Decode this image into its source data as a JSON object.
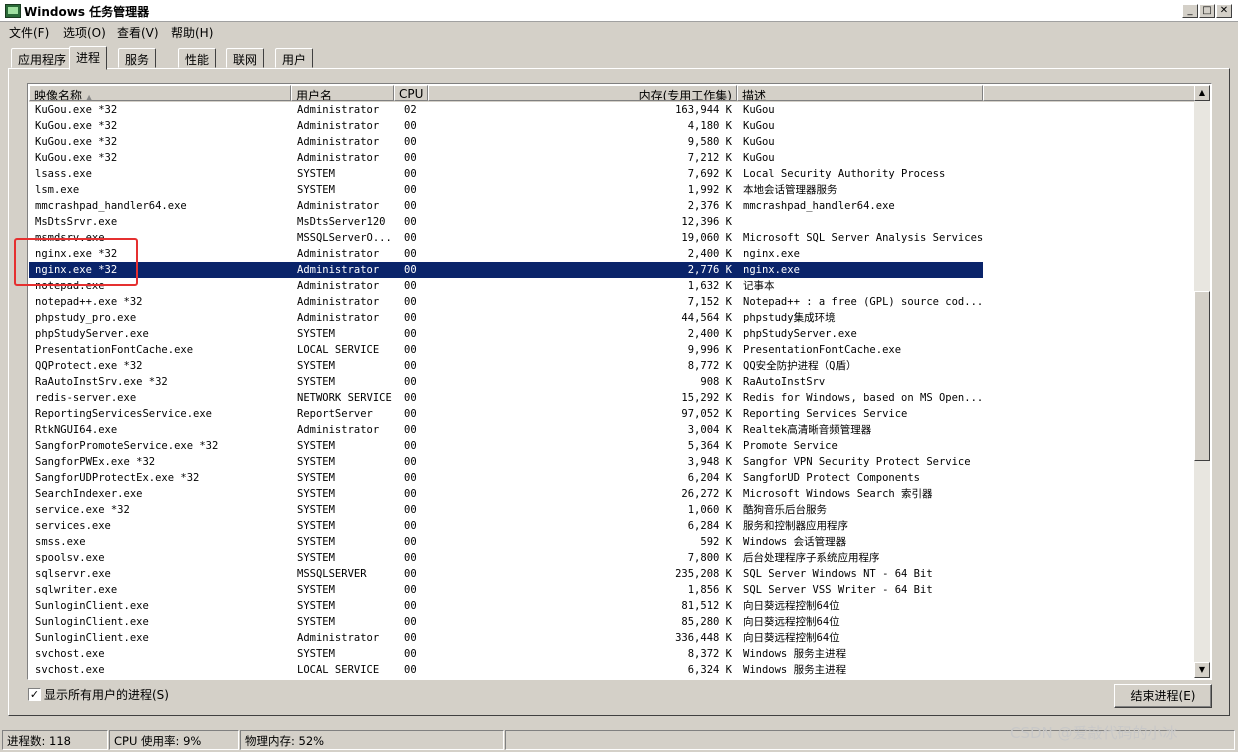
{
  "window": {
    "title": "Windows 任务管理器",
    "buttons": [
      "_",
      "□",
      "✕"
    ]
  },
  "menu": [
    "文件(F)",
    "选项(O)",
    "查看(V)",
    "帮助(H)"
  ],
  "tabs": [
    "应用程序",
    "进程",
    "服务",
    "性能",
    "联网",
    "用户"
  ],
  "active_tab": "进程",
  "columns": [
    "映像名称",
    "用户名",
    "CPU",
    "内存(专用工作集)",
    "描述"
  ],
  "processes": [
    {
      "name": "KuGou.exe *32",
      "user": "Administrator",
      "cpu": "02",
      "mem": "163,944 K",
      "desc": "KuGou"
    },
    {
      "name": "KuGou.exe *32",
      "user": "Administrator",
      "cpu": "00",
      "mem": "4,180 K",
      "desc": "KuGou"
    },
    {
      "name": "KuGou.exe *32",
      "user": "Administrator",
      "cpu": "00",
      "mem": "9,580 K",
      "desc": "KuGou"
    },
    {
      "name": "KuGou.exe *32",
      "user": "Administrator",
      "cpu": "00",
      "mem": "7,212 K",
      "desc": "KuGou"
    },
    {
      "name": "lsass.exe",
      "user": "SYSTEM",
      "cpu": "00",
      "mem": "7,692 K",
      "desc": "Local Security Authority Process"
    },
    {
      "name": "lsm.exe",
      "user": "SYSTEM",
      "cpu": "00",
      "mem": "1,992 K",
      "desc": "本地会话管理器服务"
    },
    {
      "name": "mmcrashpad_handler64.exe",
      "user": "Administrator",
      "cpu": "00",
      "mem": "2,376 K",
      "desc": "mmcrashpad_handler64.exe"
    },
    {
      "name": "MsDtsSrvr.exe",
      "user": "MsDtsServer120",
      "cpu": "00",
      "mem": "12,396 K",
      "desc": ""
    },
    {
      "name": "msmdsrv.exe",
      "user": "MSSQLServerO...",
      "cpu": "00",
      "mem": "19,060 K",
      "desc": "Microsoft SQL Server Analysis Services"
    },
    {
      "name": "nginx.exe *32",
      "user": "Administrator",
      "cpu": "00",
      "mem": "2,400 K",
      "desc": "nginx.exe"
    },
    {
      "name": "nginx.exe *32",
      "user": "Administrator",
      "cpu": "00",
      "mem": "2,776 K",
      "desc": "nginx.exe",
      "selected": true
    },
    {
      "name": "notepad.exe",
      "user": "Administrator",
      "cpu": "00",
      "mem": "1,632 K",
      "desc": "记事本"
    },
    {
      "name": "notepad++.exe *32",
      "user": "Administrator",
      "cpu": "00",
      "mem": "7,152 K",
      "desc": "Notepad++ : a free (GPL) source cod..."
    },
    {
      "name": "phpstudy_pro.exe",
      "user": "Administrator",
      "cpu": "00",
      "mem": "44,564 K",
      "desc": "phpstudy集成环境"
    },
    {
      "name": "phpStudyServer.exe",
      "user": "SYSTEM",
      "cpu": "00",
      "mem": "2,400 K",
      "desc": "phpStudyServer.exe"
    },
    {
      "name": "PresentationFontCache.exe",
      "user": "LOCAL SERVICE",
      "cpu": "00",
      "mem": "9,996 K",
      "desc": "PresentationFontCache.exe"
    },
    {
      "name": "QQProtect.exe *32",
      "user": "SYSTEM",
      "cpu": "00",
      "mem": "8,772 K",
      "desc": "QQ安全防护进程（Q盾）"
    },
    {
      "name": "RaAutoInstSrv.exe *32",
      "user": "SYSTEM",
      "cpu": "00",
      "mem": "908 K",
      "desc": "RaAutoInstSrv"
    },
    {
      "name": "redis-server.exe",
      "user": "NETWORK SERVICE",
      "cpu": "00",
      "mem": "15,292 K",
      "desc": "Redis for Windows, based on MS Open..."
    },
    {
      "name": "ReportingServicesService.exe",
      "user": "ReportServer",
      "cpu": "00",
      "mem": "97,052 K",
      "desc": "Reporting Services Service"
    },
    {
      "name": "RtkNGUI64.exe",
      "user": "Administrator",
      "cpu": "00",
      "mem": "3,004 K",
      "desc": "Realtek高清晰音频管理器"
    },
    {
      "name": "SangforPromoteService.exe *32",
      "user": "SYSTEM",
      "cpu": "00",
      "mem": "5,364 K",
      "desc": "Promote Service"
    },
    {
      "name": "SangforPWEx.exe *32",
      "user": "SYSTEM",
      "cpu": "00",
      "mem": "3,948 K",
      "desc": "Sangfor VPN Security Protect Service"
    },
    {
      "name": "SangforUDProtectEx.exe *32",
      "user": "SYSTEM",
      "cpu": "00",
      "mem": "6,204 K",
      "desc": "SangforUD Protect Components"
    },
    {
      "name": "SearchIndexer.exe",
      "user": "SYSTEM",
      "cpu": "00",
      "mem": "26,272 K",
      "desc": "Microsoft Windows Search 索引器"
    },
    {
      "name": "service.exe *32",
      "user": "SYSTEM",
      "cpu": "00",
      "mem": "1,060 K",
      "desc": "酷狗音乐后台服务"
    },
    {
      "name": "services.exe",
      "user": "SYSTEM",
      "cpu": "00",
      "mem": "6,284 K",
      "desc": "服务和控制器应用程序"
    },
    {
      "name": "smss.exe",
      "user": "SYSTEM",
      "cpu": "00",
      "mem": "592 K",
      "desc": "Windows 会话管理器"
    },
    {
      "name": "spoolsv.exe",
      "user": "SYSTEM",
      "cpu": "00",
      "mem": "7,800 K",
      "desc": "后台处理程序子系统应用程序"
    },
    {
      "name": "sqlservr.exe",
      "user": "MSSQLSERVER",
      "cpu": "00",
      "mem": "235,208 K",
      "desc": "SQL Server Windows NT - 64 Bit"
    },
    {
      "name": "sqlwriter.exe",
      "user": "SYSTEM",
      "cpu": "00",
      "mem": "1,856 K",
      "desc": "SQL Server VSS Writer - 64 Bit"
    },
    {
      "name": "SunloginClient.exe",
      "user": "SYSTEM",
      "cpu": "00",
      "mem": "81,512 K",
      "desc": "向日葵远程控制64位"
    },
    {
      "name": "SunloginClient.exe",
      "user": "SYSTEM",
      "cpu": "00",
      "mem": "85,280 K",
      "desc": "向日葵远程控制64位"
    },
    {
      "name": "SunloginClient.exe",
      "user": "Administrator",
      "cpu": "00",
      "mem": "336,448 K",
      "desc": "向日葵远程控制64位"
    },
    {
      "name": "svchost.exe",
      "user": "SYSTEM",
      "cpu": "00",
      "mem": "8,372 K",
      "desc": "Windows 服务主进程"
    },
    {
      "name": "svchost.exe",
      "user": "LOCAL SERVICE",
      "cpu": "00",
      "mem": "6,324 K",
      "desc": "Windows 服务主进程"
    }
  ],
  "show_all_users": {
    "label": "显示所有用户的进程(S)",
    "checked": "✓"
  },
  "end_process_button": "结束进程(E)",
  "status": {
    "processes": "进程数: 118",
    "cpu": "CPU 使用率: 9%",
    "memory": "物理内存: 52%"
  },
  "watermark": "CSDN @爱敲代码的小冰"
}
